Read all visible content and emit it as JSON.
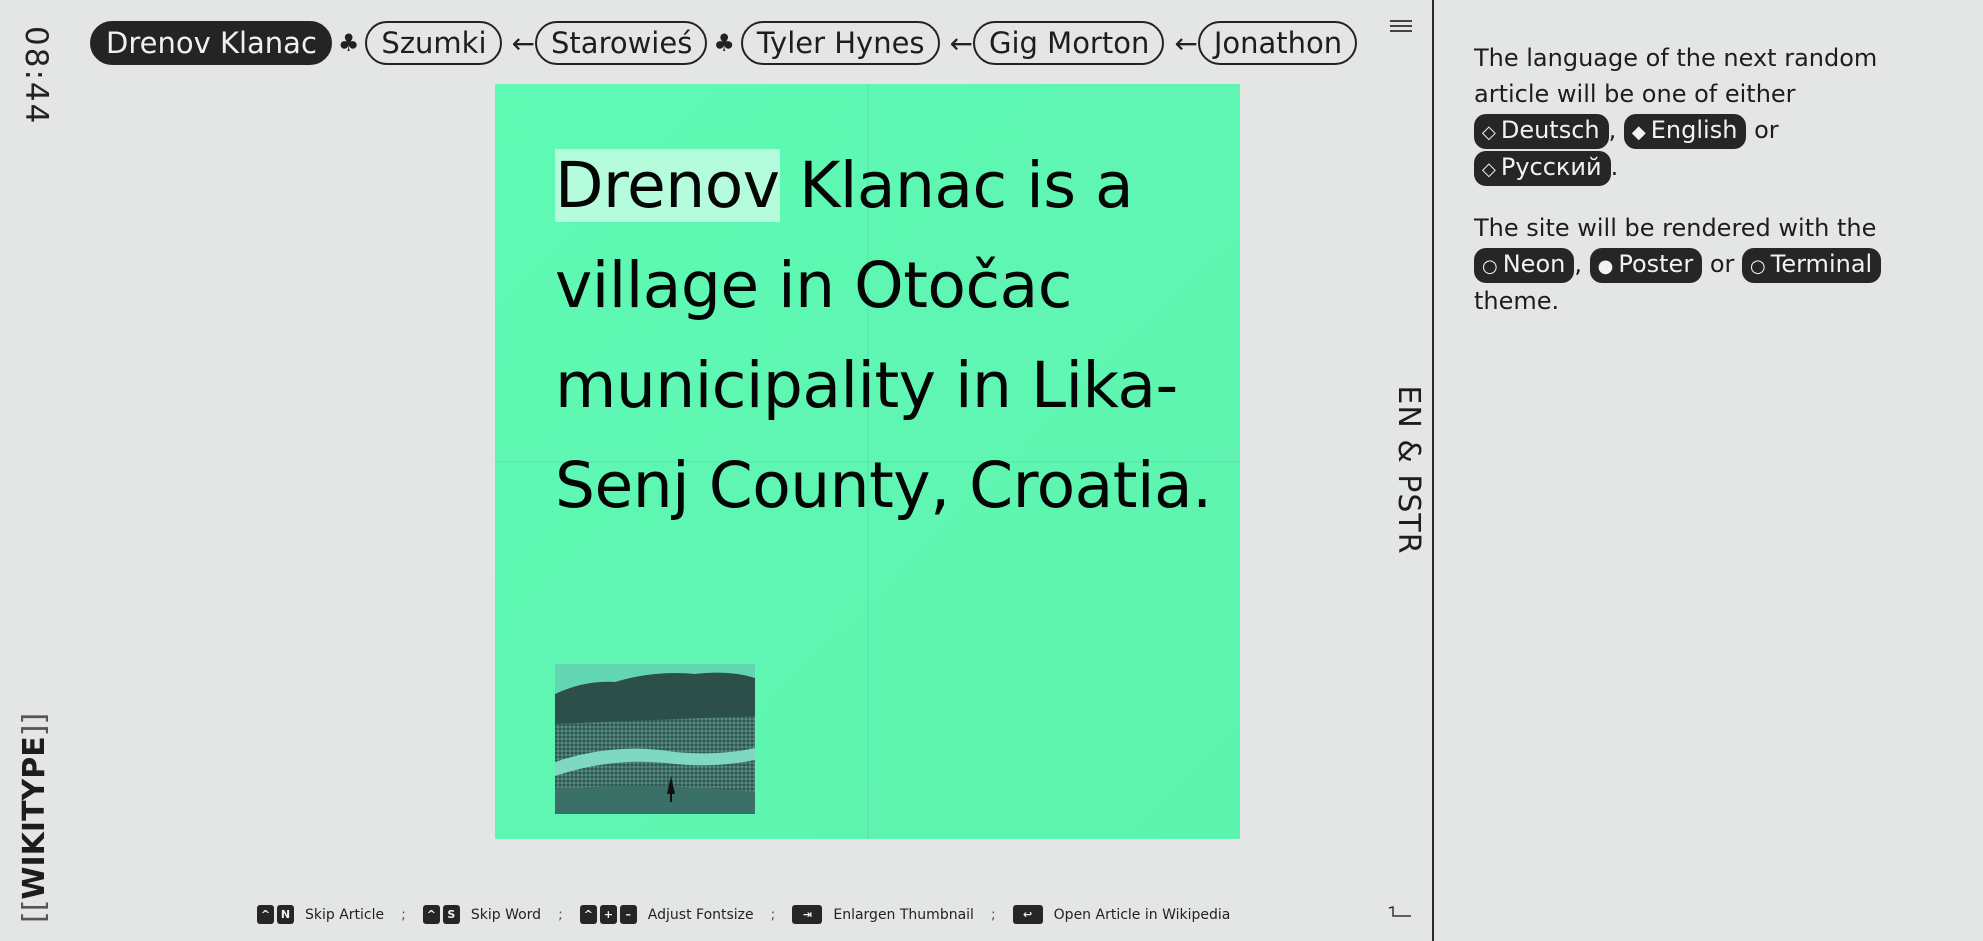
{
  "clock": "08:44",
  "brand": {
    "open": "[[",
    "name": "WIKITYPE",
    "close": "]]"
  },
  "trail": [
    {
      "label": "Drenov Klanac",
      "active": true
    },
    {
      "sep": "♣"
    },
    {
      "label": "Szumki"
    },
    {
      "sep": "←"
    },
    {
      "label": "Starowieś"
    },
    {
      "sep": "♣"
    },
    {
      "label": "Tyler Hynes"
    },
    {
      "sep": "←"
    },
    {
      "label": "Gig Morton"
    },
    {
      "sep": "←"
    },
    {
      "label": "Jonathon"
    }
  ],
  "article": {
    "highlight": "Drenov",
    "text": " Klanac is a village in Otočac municipality in Lika-Senj County, Croatia."
  },
  "lang_indicator": "EN & PSTR",
  "sidebar": {
    "lang_intro": "The language of the next random article will be one of either",
    "languages": [
      {
        "label": "Deutsch",
        "icon": "diamond-outline-icon",
        "glyph": "◇"
      },
      {
        "label": "English",
        "icon": "diamond-filled-icon",
        "glyph": "◆"
      },
      {
        "label": "Русский",
        "icon": "diamond-outline-icon",
        "glyph": "◇"
      }
    ],
    "sep_comma": ",",
    "sep_or": "or",
    "period": ".",
    "theme_intro": "The site will be rendered with the",
    "themes": [
      {
        "label": "Neon",
        "icon": "circle-outline-icon",
        "glyph": "○"
      },
      {
        "label": "Poster",
        "icon": "circle-filled-icon",
        "glyph": "●"
      },
      {
        "label": "Terminal",
        "icon": "circle-outline-icon",
        "glyph": "○"
      }
    ],
    "theme_outro": "theme."
  },
  "hints": [
    {
      "keys": [
        "^",
        "N"
      ],
      "label": "Skip Article"
    },
    {
      "keys": [
        "^",
        "S"
      ],
      "label": "Skip Word"
    },
    {
      "keys": [
        "^",
        "+",
        "–"
      ],
      "label": "Adjust Fontsize"
    },
    {
      "keys": [
        "⇥"
      ],
      "label": "Enlargen Thumbnail"
    },
    {
      "keys": [
        "↩"
      ],
      "label": "Open Article in Wikipedia"
    }
  ],
  "hint_sep": ";",
  "colors": {
    "poster_bg": "#5ef6b2",
    "highlight": "#b5fcdc",
    "chip_bg": "#262626",
    "page_bg": "#e4e6e5"
  }
}
